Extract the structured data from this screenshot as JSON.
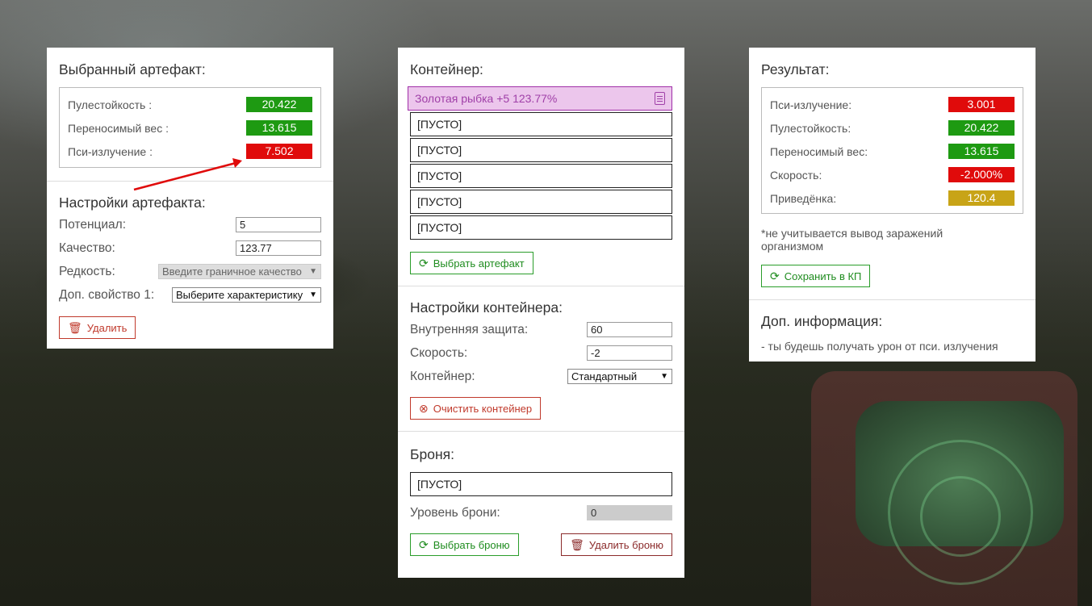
{
  "colors": {
    "green": "#1e9a12",
    "red": "#e00b0b",
    "gold": "#c8a417",
    "purple_bg": "#ecc6ec"
  },
  "artifact": {
    "title": "Выбранный артефакт:",
    "stats": [
      {
        "label": "Пулестойкость :",
        "value": "20.422",
        "color": "green"
      },
      {
        "label": "Переносимый вес :",
        "value": "13.615",
        "color": "green"
      },
      {
        "label": "Пси-излучение :",
        "value": "7.502",
        "color": "red"
      }
    ],
    "settings_title": "Настройки артефакта:",
    "potential_label": "Потенциал:",
    "potential_value": "5",
    "quality_label": "Качество:",
    "quality_value": "123.77",
    "rarity_label": "Редкость:",
    "rarity_select": "Введите граничное качество",
    "extra_label": "Доп. свойство 1:",
    "extra_select": "Выберите характеристику",
    "delete_label": "Удалить"
  },
  "container": {
    "title": "Контейнер:",
    "slots": [
      {
        "text": "Золотая рыбка +5 123.77%",
        "filled": true
      },
      {
        "text": "[ПУСТО]",
        "filled": false
      },
      {
        "text": "[ПУСТО]",
        "filled": false
      },
      {
        "text": "[ПУСТО]",
        "filled": false
      },
      {
        "text": "[ПУСТО]",
        "filled": false
      },
      {
        "text": "[ПУСТО]",
        "filled": false
      }
    ],
    "choose_label": "Выбрать артефакт",
    "settings_title": "Настройки контейнера:",
    "protection_label": "Внутренняя защита:",
    "protection_value": "60",
    "speed_label": "Скорость:",
    "speed_value": "-2",
    "type_label": "Контейнер:",
    "type_select": "Стандартный",
    "clear_label": "Очистить контейнер"
  },
  "armor": {
    "title": "Броня:",
    "slot": "[ПУСТО]",
    "level_label": "Уровень брони:",
    "level_value": "0",
    "choose_label": "Выбрать броню",
    "delete_label": "Удалить броню"
  },
  "result": {
    "title": "Результат:",
    "stats": [
      {
        "label": "Пси-излучение:",
        "value": "3.001",
        "color": "red"
      },
      {
        "label": "Пулестойкость:",
        "value": "20.422",
        "color": "green"
      },
      {
        "label": "Переносимый вес:",
        "value": "13.615",
        "color": "green"
      },
      {
        "label": "Скорость:",
        "value": "-2.000%",
        "color": "red"
      },
      {
        "label": "Приведёнка:",
        "value": "120.4",
        "color": "gold"
      }
    ],
    "note": "*не учитывается вывод заражений организмом",
    "save_label": "Сохранить в КП",
    "info_title": "Доп. информация:",
    "info_text": "- ты будешь получать урон от пси. излучения"
  }
}
